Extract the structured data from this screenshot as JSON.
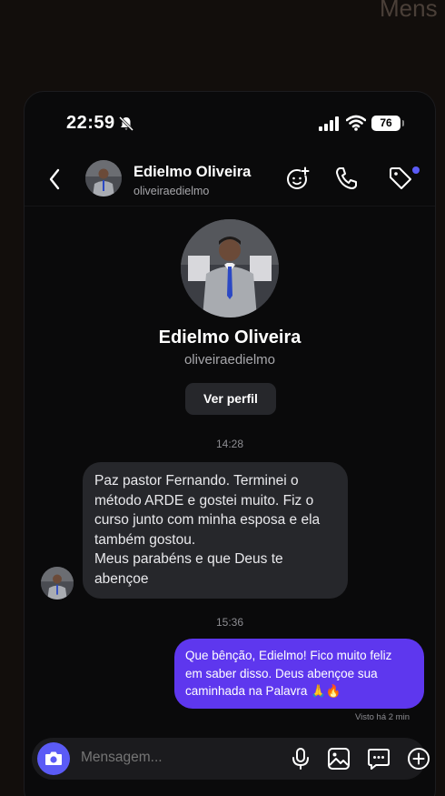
{
  "background": {
    "title_fragment": "Mens"
  },
  "status_bar": {
    "time": "22:59",
    "battery": "76"
  },
  "header": {
    "name": "Edielmo Oliveira",
    "username": "oliveiraedielmo"
  },
  "profile": {
    "name": "Edielmo Oliveira",
    "username": "oliveiraedielmo",
    "view_profile_label": "Ver perfil"
  },
  "messages": [
    {
      "timestamp": "14:28",
      "direction": "incoming",
      "lines": [
        "Paz pastor Fernando. Terminei o",
        "método ARDE e gostei muito. Fiz o",
        "curso junto com minha esposa e ela",
        "também gostou.",
        "Meus parabéns e que Deus te",
        "abençoe"
      ]
    },
    {
      "timestamp": "15:36",
      "direction": "outgoing",
      "lines": [
        "Que bênção, Edielmo! Fico muito feliz",
        "em saber disso. Deus abençoe sua",
        "caminhada na Palavra 🙏🔥"
      ],
      "seen": "Visto há 2 min"
    }
  ],
  "composer": {
    "placeholder": "Mensagem..."
  },
  "icons": {
    "status": [
      "bell-slash-icon",
      "signal-icon",
      "wifi-icon",
      "battery-icon"
    ],
    "header": [
      "back-chevron-icon",
      "add-emoji-icon",
      "phone-icon",
      "tag-icon"
    ],
    "composer": [
      "camera-icon",
      "microphone-icon",
      "image-icon",
      "sticker-icon",
      "plus-icon"
    ]
  },
  "colors": {
    "accent": "#5b5bf6",
    "outgoing_bubble": "#5e37ee",
    "incoming_bubble": "#26272b",
    "background": "#0a0a0b"
  }
}
